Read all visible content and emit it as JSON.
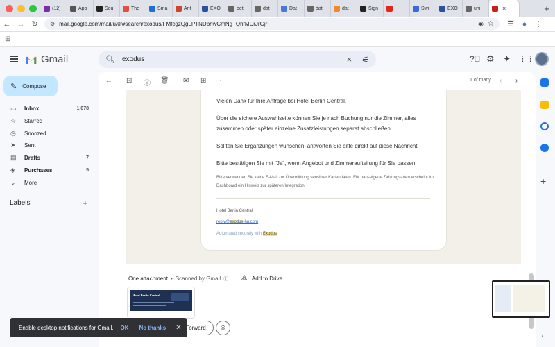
{
  "browser": {
    "tabs": [
      {
        "label": "(12)",
        "color": "#7b2ea5"
      },
      {
        "label": "App",
        "color": "#555"
      },
      {
        "label": "Sou",
        "color": "#222"
      },
      {
        "label": "The",
        "color": "#e04e3d"
      },
      {
        "label": "Sma",
        "color": "#1f6fd1"
      },
      {
        "label": "Ant",
        "color": "#c9462c"
      },
      {
        "label": "EXO",
        "color": "#2d4fa0"
      },
      {
        "label": "bet",
        "color": "#666"
      },
      {
        "label": "dat",
        "color": "#666"
      },
      {
        "label": "Dat",
        "color": "#4a78d8"
      },
      {
        "label": "dat",
        "color": "#666"
      },
      {
        "label": "dat",
        "color": "#f08b2c"
      },
      {
        "label": "Sign",
        "color": "#222"
      },
      {
        "label": "",
        "color": "#e0261b"
      },
      {
        "label": "Swi",
        "color": "#3c68d8"
      },
      {
        "label": "EXO",
        "color": "#2d4fa0"
      },
      {
        "label": "uni",
        "color": "#666"
      },
      {
        "label": "",
        "color": "#c5221f"
      }
    ],
    "url": "mail.google.com/mail/u/0/#search/exodus/FMfcgzQgLPTNDbhwCmNgTQhfMCrJrGjr"
  },
  "gmail": {
    "brand": "Gmail",
    "search_value": "exodus",
    "compose_label": "Compose",
    "nav": [
      {
        "label": "Inbox",
        "count": "1,078",
        "icon": "inbox-icon",
        "bold": true
      },
      {
        "label": "Starred",
        "count": "",
        "icon": "star-icon",
        "bold": false
      },
      {
        "label": "Snoozed",
        "count": "",
        "icon": "clock-icon",
        "bold": false
      },
      {
        "label": "Sent",
        "count": "",
        "icon": "send-icon",
        "bold": false
      },
      {
        "label": "Drafts",
        "count": "7",
        "icon": "draft-icon",
        "bold": true
      },
      {
        "label": "Purchases",
        "count": "5",
        "icon": "tag-icon",
        "bold": true
      },
      {
        "label": "More",
        "count": "",
        "icon": "chevron-down-icon",
        "bold": false
      }
    ],
    "labels_heading": "Labels",
    "pager": "1 of many"
  },
  "message": {
    "p1": "Vielen Dank für Ihre Anfrage bei Hotel Berlin Central.",
    "p2": "Über die sichere Auswahlseite können Sie je nach Buchung nur die Zimmer, alles zusammen oder später einzelne Zusatzleistungen separat abschließen.",
    "p3": "Sollten Sie Ergänzungen wünschen, antworten Sie bitte direkt auf diese Nachricht.",
    "p4": "Bitte bestätigen Sie mit \"Ja\", wenn Angebot und Zimmeraufteilung für Sie passen.",
    "note": "Bitte verwenden Sie keine E-Mail zur Übermittlung sensibler Kartendaten. Für hauseigene Zahlungsarten erscheint im Dashboard ein Hinweis zur späteren Integration.",
    "signature_name": "Hotel Berlin Central",
    "signature_email_pre": "reply@",
    "signature_email_hl": "exodus",
    "signature_email_post": "-hq.com",
    "automated_pre": "Automated securely with ",
    "automated_hl": "Exodus"
  },
  "attachments": {
    "heading": "One attachment",
    "scanned": "Scanned by Gmail",
    "add_to_drive": "Add to Drive",
    "thumb_title": "Hotel Berlin Central"
  },
  "actions": {
    "forward": "Forward"
  },
  "toast": {
    "text": "Enable desktop notifications for Gmail.",
    "ok": "OK",
    "no_thanks": "No thanks"
  }
}
